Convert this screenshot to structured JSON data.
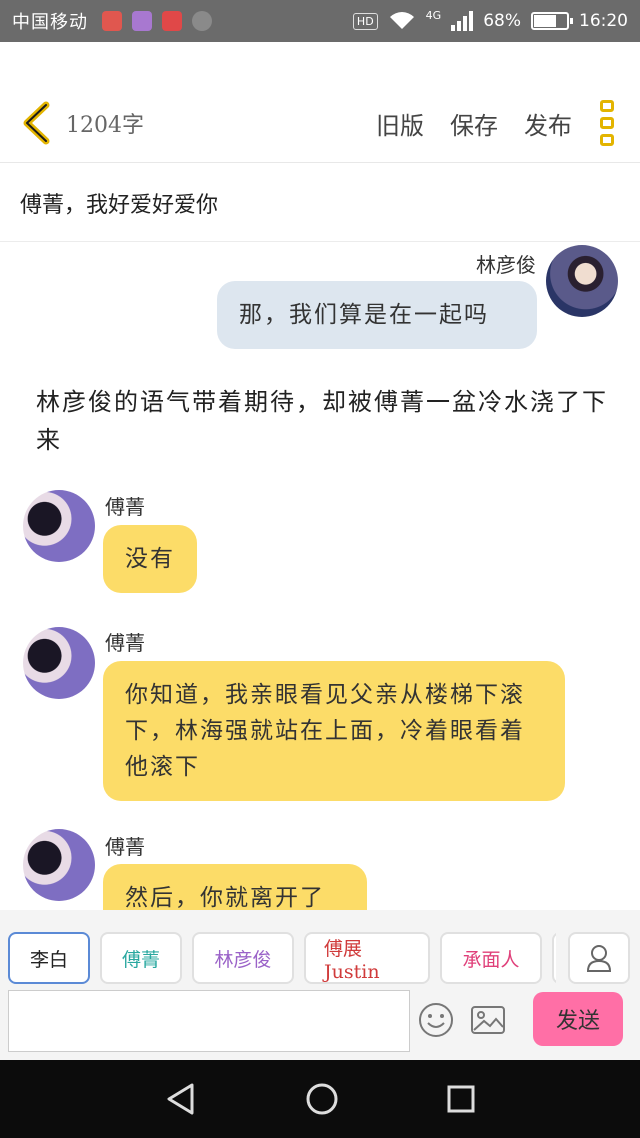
{
  "status_bar": {
    "carrier": "中国移动",
    "hd": "HD",
    "network": "4G",
    "battery_text": "68%",
    "battery_level": 0.68,
    "time": "16:20"
  },
  "toolbar": {
    "word_count": "1204字",
    "actions": [
      "旧版",
      "保存",
      "发布"
    ]
  },
  "title": "傅菁，我好爱好爱你",
  "messages": {
    "m1": {
      "speaker": "林彦俊",
      "text": "那，我们算是在一起吗"
    },
    "narration": "林彦俊的语气带着期待，却被傅菁一盆冷水浇了下来",
    "m2": {
      "speaker": "傅菁",
      "text": "没有"
    },
    "m3": {
      "speaker": "傅菁",
      "text": "你知道，我亲眼看见父亲从楼梯下滚下，林海强就站在上面，冷着眼看着他滚下"
    },
    "m4": {
      "speaker": "傅菁",
      "text": "然后，你就离开了"
    }
  },
  "roles": [
    {
      "label": "李白",
      "color": "#333333"
    },
    {
      "label": "傅菁",
      "color": "#2aa8a0"
    },
    {
      "label": "林彦俊",
      "color": "#9a62c8"
    },
    {
      "label": "傅展Justin",
      "color": "#d03a3a"
    },
    {
      "label": "承面人",
      "color": "#e0407a"
    }
  ],
  "composer": {
    "input_value": "",
    "send_label": "发送"
  },
  "colors": {
    "accent_yellow": "#fcdc68",
    "bubble_gray": "#dde6ef",
    "send_pink": "#ff6fa6",
    "back_arrow": "#e3b400"
  }
}
